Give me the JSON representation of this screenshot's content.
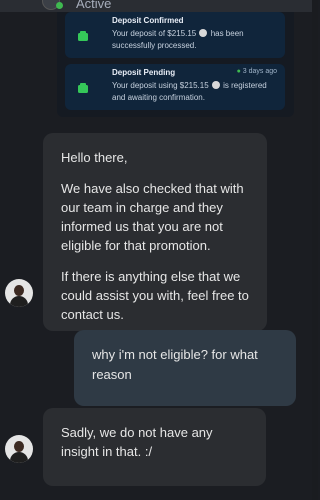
{
  "header": {
    "status": "Active"
  },
  "notifications": [
    {
      "title": "Deposit Confirmed",
      "body_before": "Your deposit of $215.15",
      "body_after": "has been successfully processed."
    },
    {
      "title": "Deposit Pending",
      "time": "3 days ago",
      "body_before": "Your deposit using $215.15",
      "body_after": "is registered and awaiting confirmation."
    }
  ],
  "messages": [
    {
      "from": "agent",
      "paragraphs": [
        "Hello there,",
        "We have also checked that with our team in charge and they informed us that you are not eligible for that promotion.",
        "If there is anything else that we could assist you with, feel free to contact us."
      ]
    },
    {
      "from": "user",
      "text": "why i'm not eligible? for what reason"
    },
    {
      "from": "agent",
      "text": "Sadly, we do not have any insight in that. :/"
    }
  ],
  "colors": {
    "background": "#1b1d22",
    "agent_bubble": "#2b2d31",
    "user_bubble": "#2f3a45",
    "notification_bg": "#10253b",
    "success": "#3fb950"
  }
}
